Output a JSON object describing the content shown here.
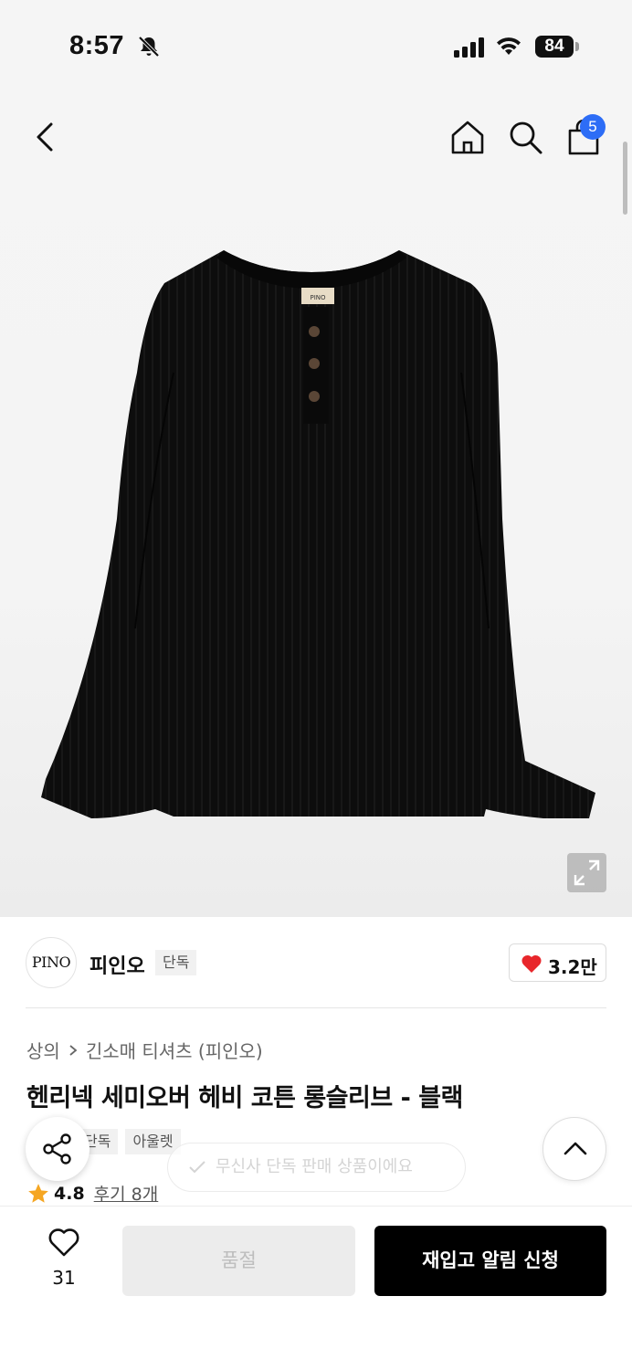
{
  "status_bar": {
    "time": "8:57",
    "battery": "84",
    "icons": [
      "bell-slash-icon",
      "signal-icon",
      "wifi-icon",
      "battery-icon"
    ]
  },
  "header": {
    "icons": [
      "back-arrow-icon",
      "home-icon",
      "search-icon",
      "shopping-bag-icon"
    ],
    "cart_count": "5"
  },
  "product_image": {
    "label_text": "PINO",
    "expand_icon": "expand-icon"
  },
  "brand": {
    "logo_text": "PINO",
    "name": "피인오",
    "badge": "단독",
    "like_count": "3.2만"
  },
  "breadcrumb": {
    "category": "상의",
    "subcategory": "긴소매 티셔츠 (피인오)"
  },
  "product": {
    "title": "헨리넥 세미오버 헤비 코튼 롱슬리브 - 블랙",
    "tags": [
      "단독",
      "아울렛"
    ],
    "rating": "4.8",
    "review_text": "후기 8개"
  },
  "toast": {
    "text": "무신사 단독 판매 상품이에요"
  },
  "bottom_bar": {
    "wish_count": "31",
    "soldout_label": "품절",
    "restock_label": "재입고 알림 신청"
  },
  "colors": {
    "accent": "#2d6df6",
    "heart": "#e8262b",
    "star": "#f5a623",
    "primary_button": "#000000"
  }
}
